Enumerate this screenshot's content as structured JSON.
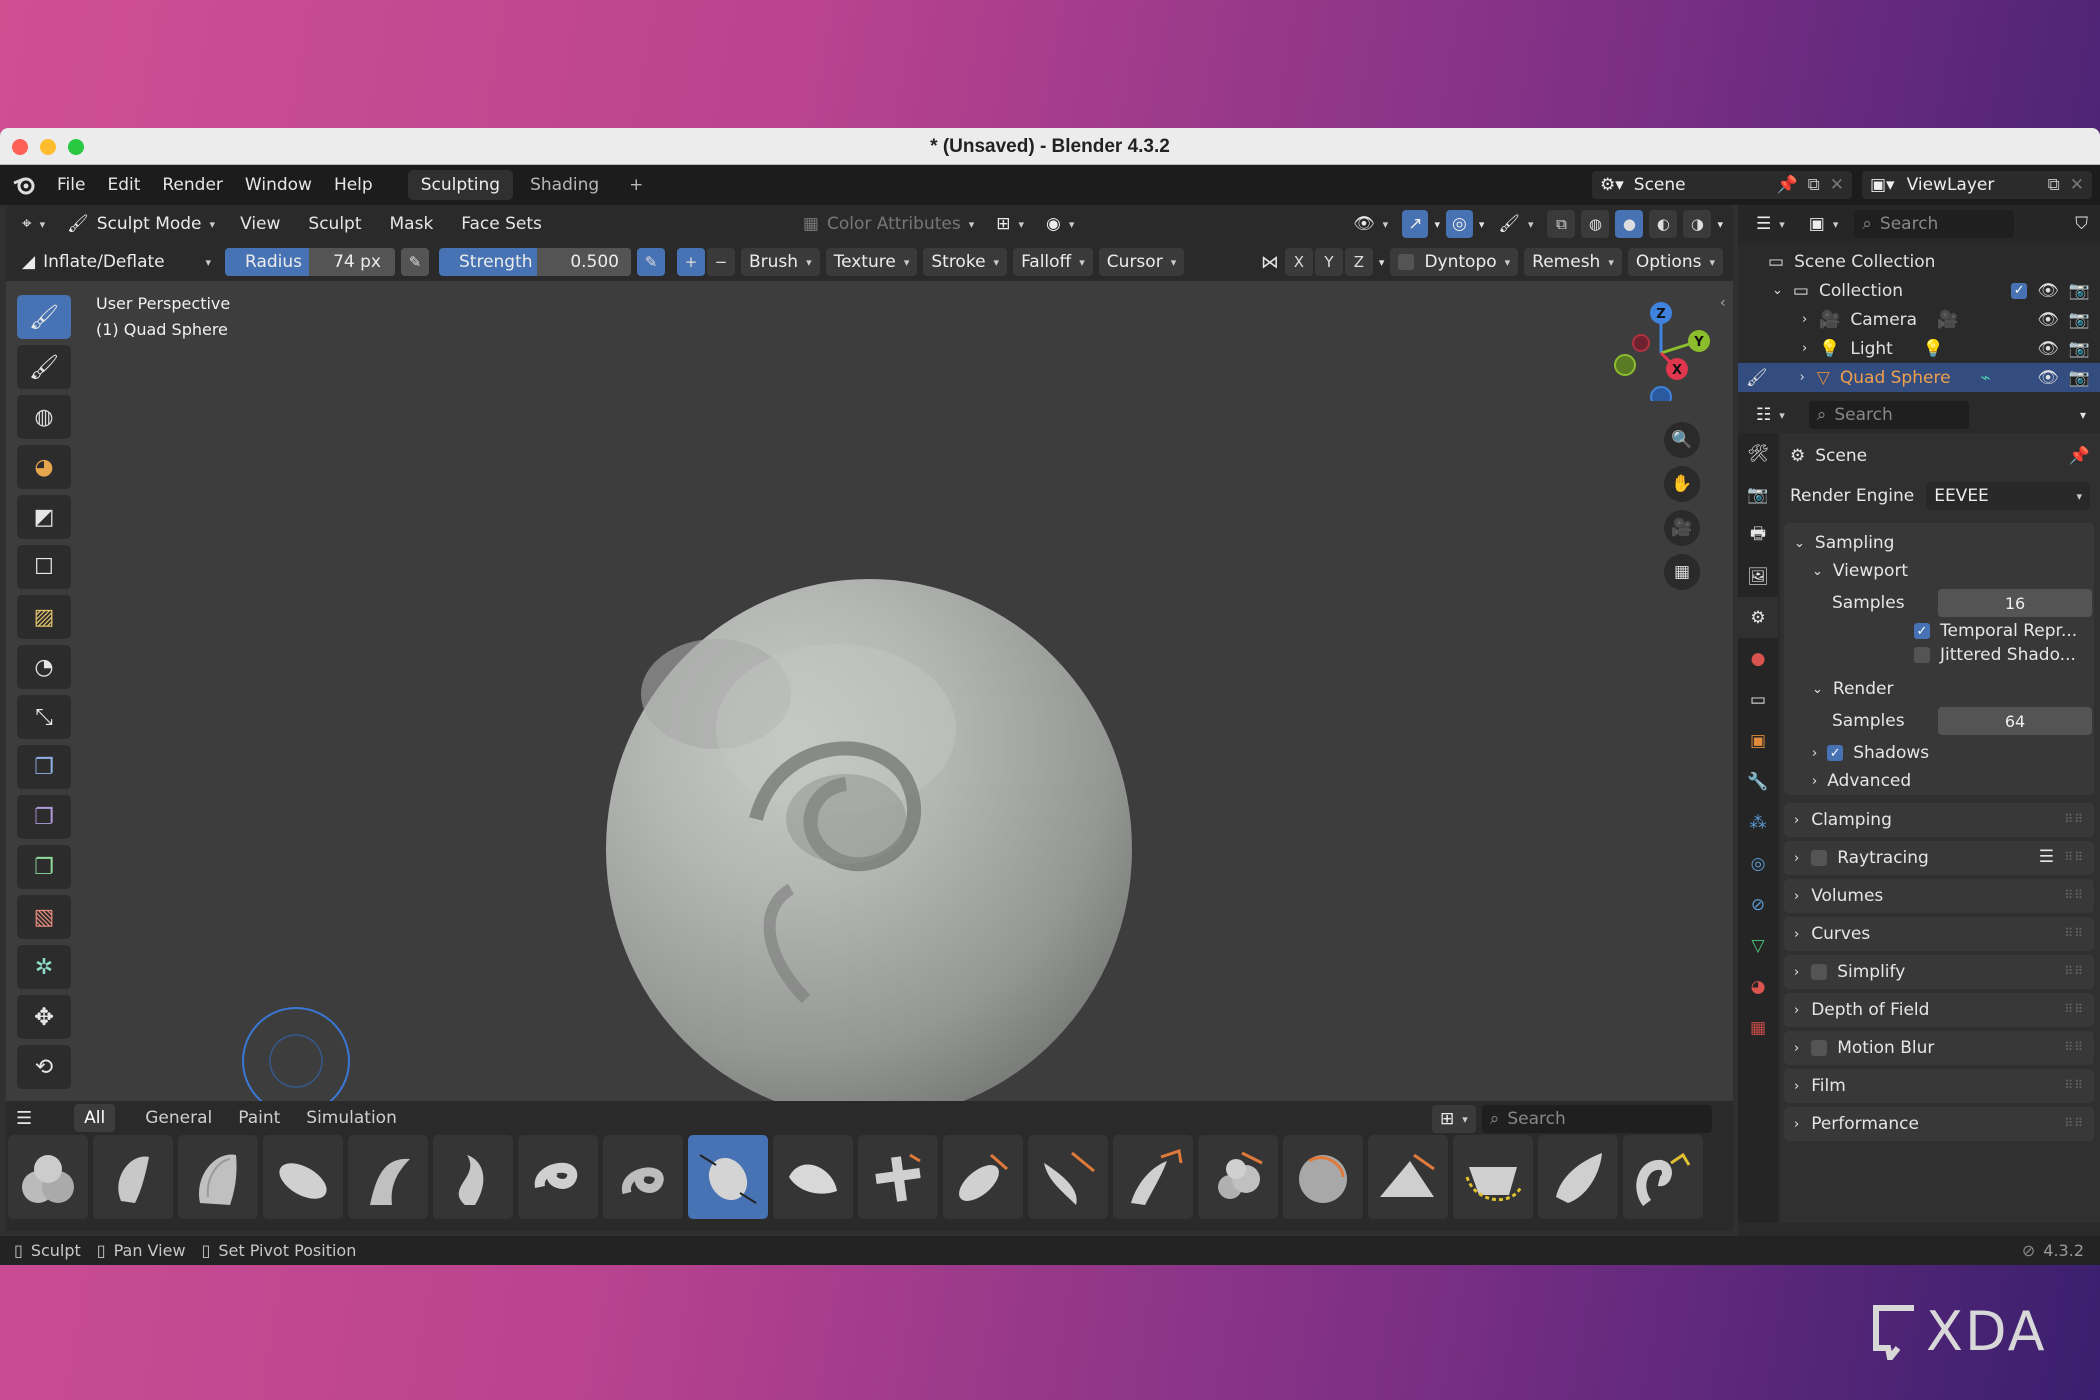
{
  "window": {
    "title": "* (Unsaved) - Blender 4.3.2"
  },
  "menu": {
    "items": [
      "File",
      "Edit",
      "Render",
      "Window",
      "Help"
    ],
    "workspaces": [
      "Sculpting",
      "Shading"
    ],
    "add_tab": "+",
    "scene": "Scene",
    "viewlayer": "ViewLayer"
  },
  "header": {
    "mode": "Sculpt Mode",
    "menus": [
      "View",
      "Sculpt",
      "Mask",
      "Face Sets"
    ],
    "color_attributes": "Color Attributes"
  },
  "toolheader": {
    "brush_name": "Inflate/Deflate",
    "radius_label": "Radius",
    "radius_value": "74 px",
    "strength_label": "Strength",
    "strength_value": "0.500",
    "plus": "+",
    "minus": "−",
    "menus": [
      "Brush",
      "Texture",
      "Stroke",
      "Falloff",
      "Cursor"
    ],
    "axes": [
      "X",
      "Y",
      "Z"
    ],
    "dyntopo": "Dyntopo",
    "remesh": "Remesh",
    "options": "Options"
  },
  "viewport": {
    "perspective": "User Perspective",
    "object": "(1) Quad Sphere",
    "gizmo_axes": [
      "Z",
      "Y",
      "X"
    ]
  },
  "asset_shelf": {
    "tabs": [
      "All",
      "General",
      "Paint",
      "Simulation"
    ],
    "search_placeholder": "Search"
  },
  "outliner": {
    "search_placeholder": "Search",
    "scene_collection": "Scene Collection",
    "collection": "Collection",
    "items": [
      "Camera",
      "Light",
      "Quad Sphere"
    ]
  },
  "properties": {
    "search_placeholder": "Search",
    "scene": "Scene",
    "render_engine_label": "Render Engine",
    "render_engine": "EEVEE",
    "sampling": "Sampling",
    "viewport": "Viewport",
    "samples_label": "Samples",
    "viewport_samples": "16",
    "temporal": "Temporal Repr...",
    "jittered": "Jittered Shado...",
    "render": "Render",
    "render_samples": "64",
    "shadows": "Shadows",
    "advanced": "Advanced",
    "sections": [
      "Clamping",
      "Raytracing",
      "Volumes",
      "Curves",
      "Simplify",
      "Depth of Field",
      "Motion Blur",
      "Film",
      "Performance"
    ]
  },
  "status": {
    "items": [
      "Sculpt",
      "Pan View",
      "Set Pivot Position"
    ],
    "version": "4.3.2"
  },
  "watermark": "XDA",
  "colors": {
    "accent": "#4772b3",
    "object_orange": "#e08c3c",
    "axis_x": "#e0364e",
    "axis_y": "#8bbd2c",
    "axis_z": "#3f83de"
  }
}
